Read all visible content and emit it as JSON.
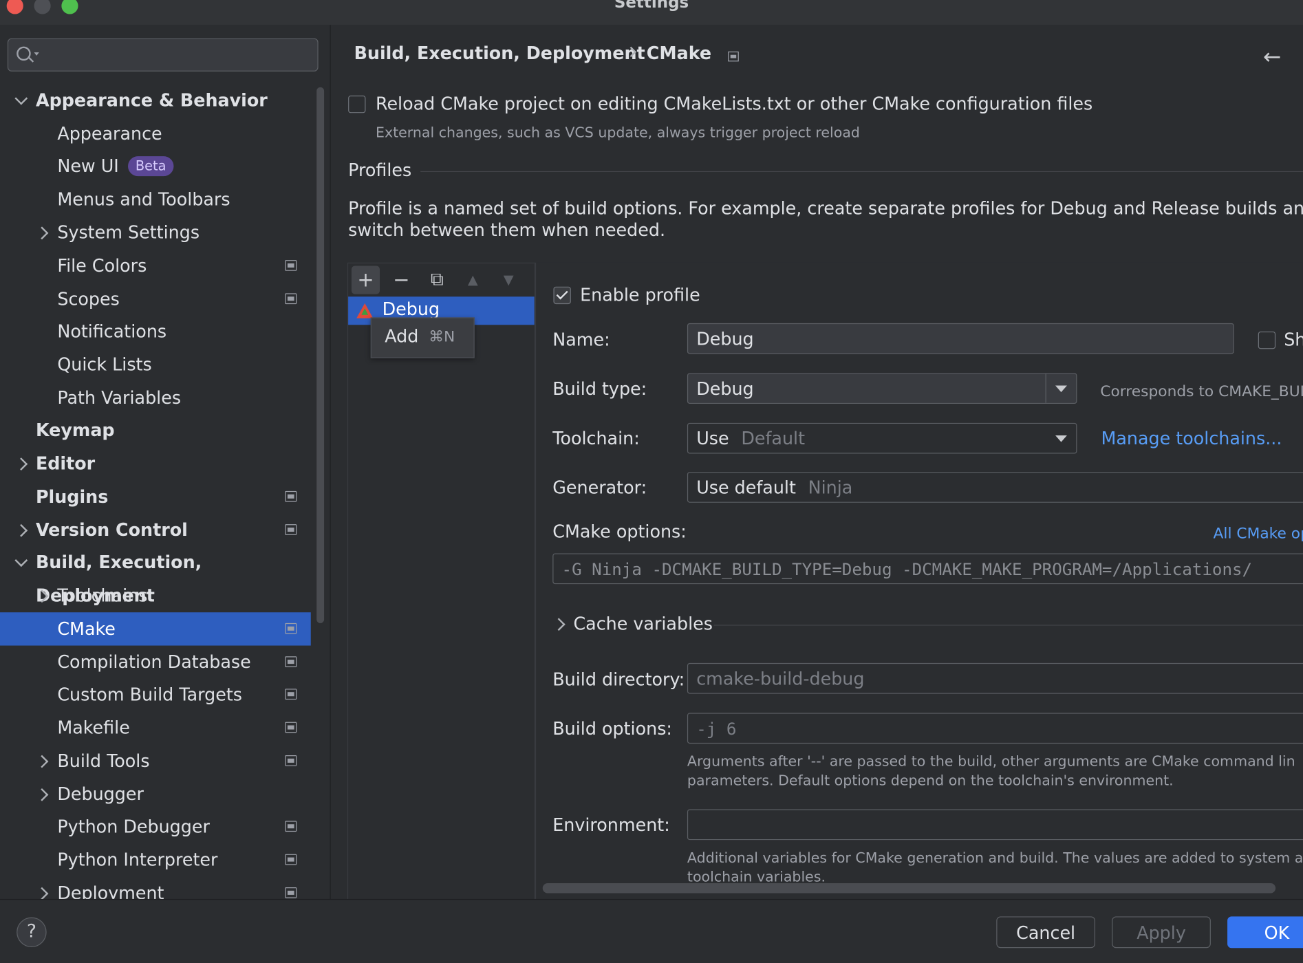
{
  "window": {
    "title": "Settings"
  },
  "search": {
    "placeholder": ""
  },
  "sidebar": {
    "items": [
      {
        "label": "Appearance & Behavior"
      },
      {
        "label": "Appearance"
      },
      {
        "label": "New UI",
        "badge": "Beta"
      },
      {
        "label": "Menus and Toolbars"
      },
      {
        "label": "System Settings"
      },
      {
        "label": "File Colors"
      },
      {
        "label": "Scopes"
      },
      {
        "label": "Notifications"
      },
      {
        "label": "Quick Lists"
      },
      {
        "label": "Path Variables"
      },
      {
        "label": "Keymap"
      },
      {
        "label": "Editor"
      },
      {
        "label": "Plugins"
      },
      {
        "label": "Version Control"
      },
      {
        "label": "Build, Execution, Deployment"
      },
      {
        "label": "Toolchains"
      },
      {
        "label": "CMake",
        "selected": true
      },
      {
        "label": "Compilation Database"
      },
      {
        "label": "Custom Build Targets"
      },
      {
        "label": "Makefile"
      },
      {
        "label": "Build Tools"
      },
      {
        "label": "Debugger"
      },
      {
        "label": "Python Debugger"
      },
      {
        "label": "Python Interpreter"
      },
      {
        "label": "Deployment"
      }
    ]
  },
  "breadcrumb": {
    "parent": "Build, Execution, Deployment",
    "current": "CMake"
  },
  "reload": {
    "label": "Reload CMake project on editing CMakeLists.txt or other CMake configuration files",
    "hint": "External changes, such as VCS update, always trigger project reload",
    "checked": false
  },
  "profiles": {
    "section_title": "Profiles",
    "description_line1": "Profile is a named set of build options. For example, create separate profiles for Debug and Release builds and",
    "description_line2": "switch between them when needed.",
    "toolbar": {
      "add": "+",
      "remove": "−",
      "copy": "⧉",
      "up": "▲",
      "down": "▼"
    },
    "list": [
      {
        "name": "Debug",
        "selected": true
      }
    ],
    "tooltip": {
      "label": "Add",
      "shortcut": "⌘N"
    }
  },
  "form": {
    "enable_label": "Enable profile",
    "enable_checked": true,
    "name_label": "Name:",
    "name_value": "Debug",
    "share_label": "Sh",
    "build_type_label": "Build type:",
    "build_type_value": "Debug",
    "build_type_hint": "Corresponds to CMAKE_BUIL",
    "toolchain_label": "Toolchain:",
    "toolchain_value": "Use",
    "toolchain_default": "Default",
    "manage_toolchains": "Manage toolchains...",
    "generator_label": "Generator:",
    "generator_value": "Use default",
    "generator_default": "Ninja",
    "cmake_options_label": "CMake options:",
    "all_cmake_options": "All CMake op",
    "cmake_options_value": "-G Ninja -DCMAKE_BUILD_TYPE=Debug -DCMAKE_MAKE_PROGRAM=/Applications/",
    "cache_variables_label": "Cache variables",
    "build_directory_label": "Build directory:",
    "build_directory_value": "cmake-build-debug",
    "build_options_label": "Build options:",
    "build_options_value": "-j 6",
    "build_options_hint_1": "Arguments after '--' are passed to the build, other arguments are CMake command lin",
    "build_options_hint_2": "parameters. Default options depend on the toolchain's environment.",
    "environment_label": "Environment:",
    "environment_value": "",
    "environment_hint_1": "Additional variables for CMake generation and build. The values are added to system a",
    "environment_hint_2": "toolchain variables."
  },
  "buttons": {
    "cancel": "Cancel",
    "apply": "Apply",
    "ok": "OK",
    "help": "?"
  },
  "colors": {
    "accent": "#2e5ebf",
    "link": "#589df6",
    "primary_button": "#3574f0",
    "background": "#2b2d30"
  }
}
